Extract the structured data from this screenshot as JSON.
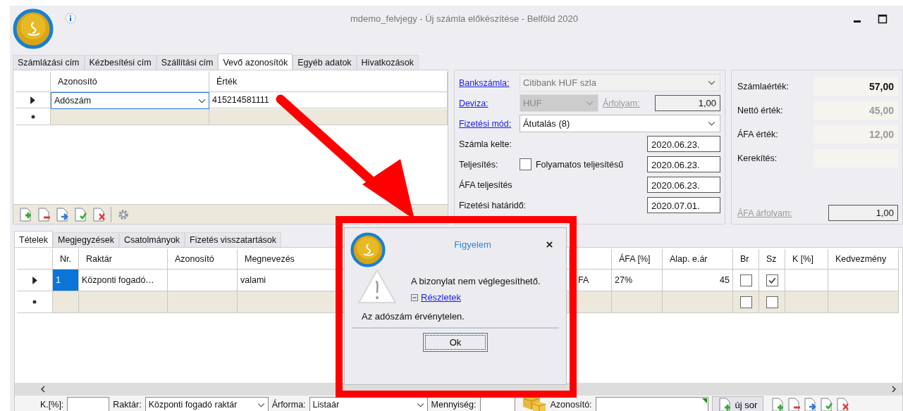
{
  "window": {
    "title": "mdemo_felvjegy - Új számla előkészítése - Belföld 2020"
  },
  "top_tabs": [
    {
      "label": "Számlázási cím",
      "selected": false
    },
    {
      "label": "Kézbesítési cím",
      "selected": false
    },
    {
      "label": "Szállítási cím",
      "selected": false
    },
    {
      "label": "Vevő azonosítók",
      "selected": true
    },
    {
      "label": "Egyéb adatok",
      "selected": false
    },
    {
      "label": "Hivatkozások",
      "selected": false
    }
  ],
  "id_grid": {
    "columns": [
      "Azonosító",
      "Érték"
    ],
    "rows": [
      {
        "current": true,
        "azonosito": "Adószám",
        "ertek": "415214581111"
      }
    ]
  },
  "form": [
    {
      "kind": "combo",
      "label": "Bankszámla:",
      "link": true,
      "value": "Citibank HUF szla",
      "disabled": true
    },
    {
      "kind": "currency",
      "label": "Deviza:",
      "link": true,
      "value": "HUF",
      "rate_label": "Árfolyam:",
      "rate": "1,00"
    },
    {
      "kind": "combo",
      "label": "Fizetési mód:",
      "link": true,
      "value": "Átutalás (8)",
      "disabled": false
    },
    {
      "kind": "date",
      "label": "Számla kelte:",
      "link": false,
      "value": "2020.06.23."
    },
    {
      "kind": "date_check",
      "label": "Teljesítés:",
      "link": false,
      "check_label": "Folyamatos teljesítésű",
      "checked": false,
      "value": "2020.06.23."
    },
    {
      "kind": "date",
      "label": "ÁFA teljesítés",
      "link": false,
      "value": "2020.06.23."
    },
    {
      "kind": "date",
      "label": "Fizetési határidő:",
      "link": false,
      "value": "2020.07.01."
    }
  ],
  "totals": [
    {
      "label": "Számlaérték:",
      "value": "57,00",
      "emphasis": true
    },
    {
      "label": "Nettó érték:",
      "value": "45,00",
      "emphasis": false
    },
    {
      "label": "ÁFA érték:",
      "value": "12,00",
      "emphasis": false
    },
    {
      "label": "Kerekítés:"
    }
  ],
  "afa_arfolyam": {
    "label": "ÁFA árfolyam:",
    "value": "1,00"
  },
  "bottom_tabs": [
    {
      "label": "Tételek",
      "selected": true
    },
    {
      "label": "Megjegyzések",
      "selected": false
    },
    {
      "label": "Csatolmányok",
      "selected": false
    },
    {
      "label": "Fizetés visszatartások",
      "selected": false
    }
  ],
  "items_grid": {
    "columns": [
      {
        "label": "Nr."
      },
      {
        "label": "Raktár"
      },
      {
        "label": "Azonosító"
      },
      {
        "label": "Megnevezés"
      },
      {},
      {
        "label": "ÁFA [%]"
      },
      {
        "label": "Alap. e.ár"
      },
      {
        "label": "Br"
      },
      {
        "label": "Sz"
      },
      {
        "label": "K [%]"
      },
      {
        "label": "Kedvezmény"
      }
    ],
    "rows": [
      {
        "current": true,
        "nr_selected": true,
        "nr": "1",
        "raktar": "Központi fogadó…",
        "megnevezes": "valami",
        "column_5": "FA",
        "afa": "27%",
        "alap_ear": "45",
        "br": false,
        "sz": true
      }
    ],
    "new_row": {
      "br": false,
      "sz": false
    }
  },
  "bottom_bar": {
    "k_label": "K.[%]:",
    "raktar_label": "Raktár:",
    "raktar": "Központi fogadó raktár",
    "arforma_label": "Árforma:",
    "arforma": "Listaár",
    "mennyiseg_label": "Mennyiség:",
    "azonosito_label": "Azonosító:",
    "new_row_button": "új sor"
  },
  "dialog": {
    "title": "Figyelem",
    "message": "A bizonylat nem véglegesíthető.",
    "details_link": "Részletek",
    "details_expanded": true,
    "detail_text": "Az adószám érvénytelen.",
    "button": "Ok"
  }
}
